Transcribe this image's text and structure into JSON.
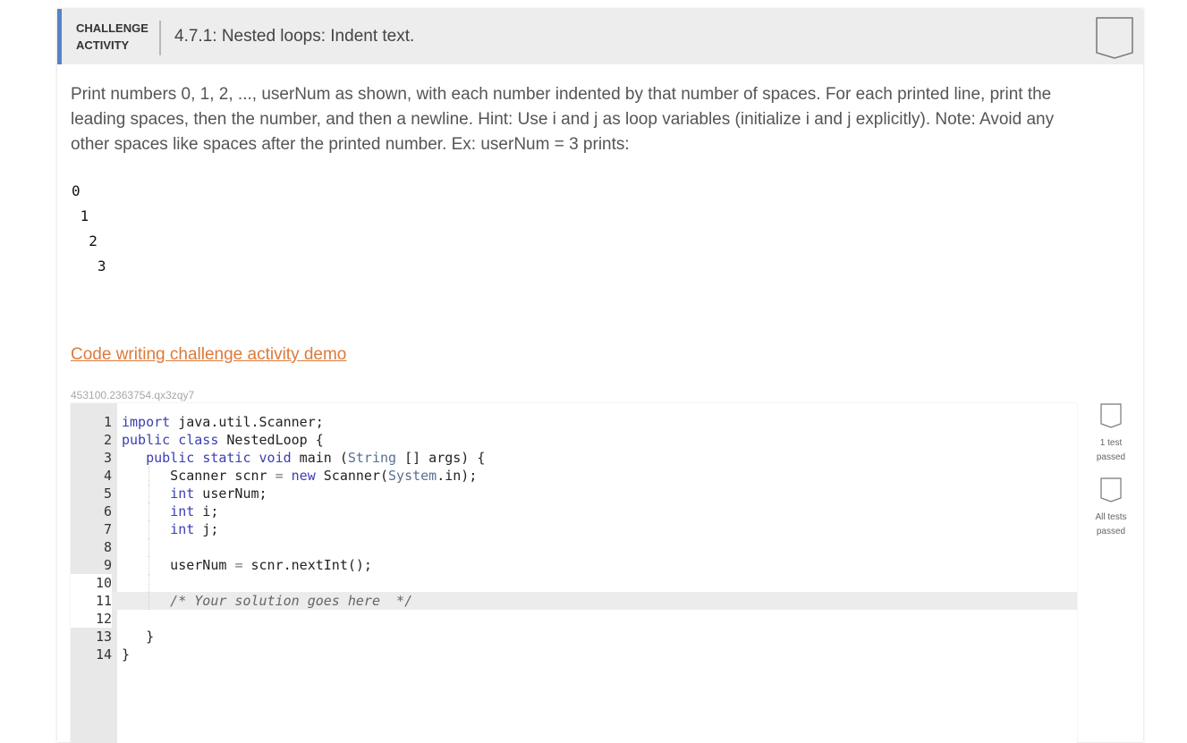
{
  "header": {
    "type_line1": "CHALLENGE",
    "type_line2": "ACTIVITY",
    "title": "4.7.1: Nested loops: Indent text.",
    "badge_icon": "completion-badge-icon"
  },
  "prompt": "Print numbers 0, 1, 2, ..., userNum as shown, with each number indented by that number of spaces. For each printed line, print the leading spaces, then the number, and then a newline. Hint: Use i and j as loop variables (initialize i and j explicitly). Note: Avoid any other spaces like spaces after the printed number. Ex: userNum = 3 prints:",
  "example_output": [
    "0",
    " 1",
    "  2",
    "   3"
  ],
  "demo_link": "Code writing challenge activity demo",
  "activity_id": "453100.2363754.qx3zqy7",
  "editor": {
    "lines": [
      {
        "n": "1",
        "text": "import java.util.Scanner;"
      },
      {
        "n": "2",
        "text": "public class NestedLoop {"
      },
      {
        "n": "3",
        "text": "   public static void main (String [] args) {"
      },
      {
        "n": "4",
        "text": "      Scanner scnr = new Scanner(System.in);"
      },
      {
        "n": "5",
        "text": "      int userNum;"
      },
      {
        "n": "6",
        "text": "      int i;"
      },
      {
        "n": "7",
        "text": "      int j;"
      },
      {
        "n": "8",
        "text": ""
      },
      {
        "n": "9",
        "text": "      userNum = scnr.nextInt();"
      },
      {
        "n": "10",
        "text": ""
      },
      {
        "n": "11",
        "text": "      /* Your solution goes here  */"
      },
      {
        "n": "12",
        "text": ""
      },
      {
        "n": "13",
        "text": "   }"
      },
      {
        "n": "14",
        "text": "}"
      }
    ],
    "active_line": "11"
  },
  "tests": [
    {
      "label_line1": "1 test",
      "label_line2": "passed",
      "icon": "test-badge-icon"
    },
    {
      "label_line1": "All tests",
      "label_line2": "passed",
      "icon": "test-badge-icon"
    }
  ]
}
